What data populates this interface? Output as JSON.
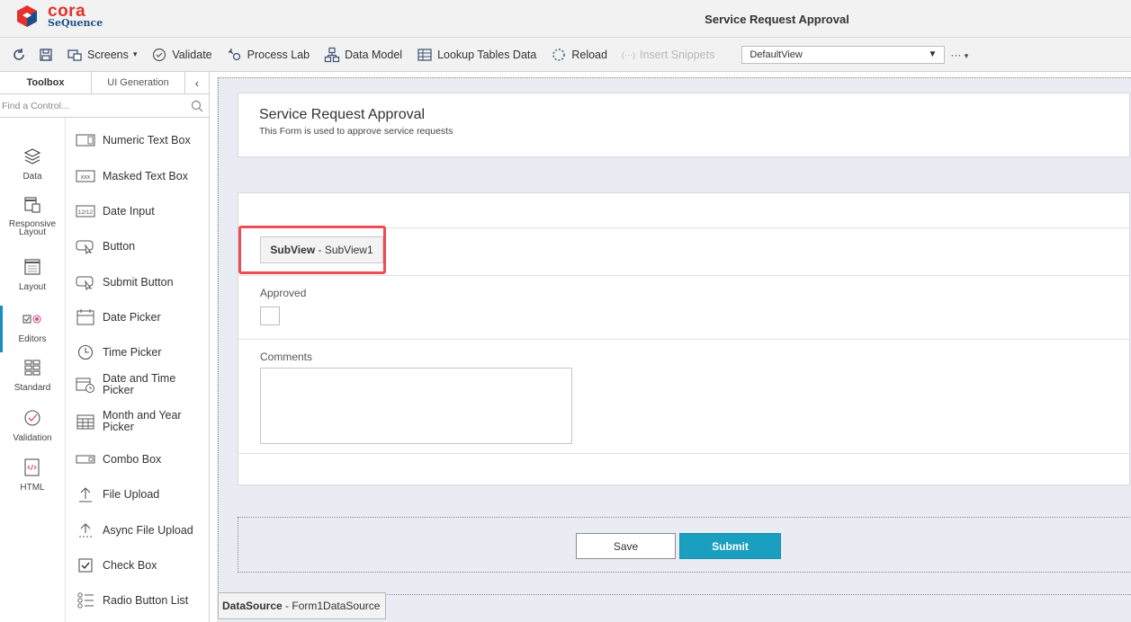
{
  "app": {
    "brand_name": "cora",
    "brand_sub": "SeQuence",
    "window_title": "Service Request Approval"
  },
  "toolbar": {
    "screens": "Screens",
    "validate": "Validate",
    "process_lab": "Process Lab",
    "data_model": "Data Model",
    "lookup_tables": "Lookup Tables Data",
    "reload": "Reload",
    "insert_snippets": "Insert Snippets",
    "view_select": "DefaultView",
    "more": "···"
  },
  "toolbox": {
    "tabs": [
      "Toolbox",
      "UI Generation"
    ],
    "search_placeholder": "Find a Control...",
    "categories": [
      "Data",
      "Responsive Layout",
      "Layout",
      "Editors",
      "Standard",
      "Validation",
      "HTML"
    ],
    "active_category": "Editors",
    "controls": [
      "Numeric Text Box",
      "Masked Text Box",
      "Date Input",
      "Button",
      "Submit Button",
      "Date Picker",
      "Time Picker",
      "Date and Time Picker",
      "Month and Year Picker",
      "Combo Box",
      "File Upload",
      "Async File Upload",
      "Check Box",
      "Radio Button List"
    ]
  },
  "form": {
    "title": "Service Request Approval",
    "description": "This Form is used to approve service requests",
    "subview_type": "SubView",
    "subview_name": " - SubView1",
    "approved_label": "Approved",
    "comments_label": "Comments",
    "save_label": "Save",
    "submit_label": "Submit",
    "datasource_type": "DataSource",
    "datasource_name": " - Form1DataSource"
  },
  "colors": {
    "accent": "#1a9fc0",
    "highlight": "#ef4b55",
    "brand_red": "#e4322b"
  }
}
